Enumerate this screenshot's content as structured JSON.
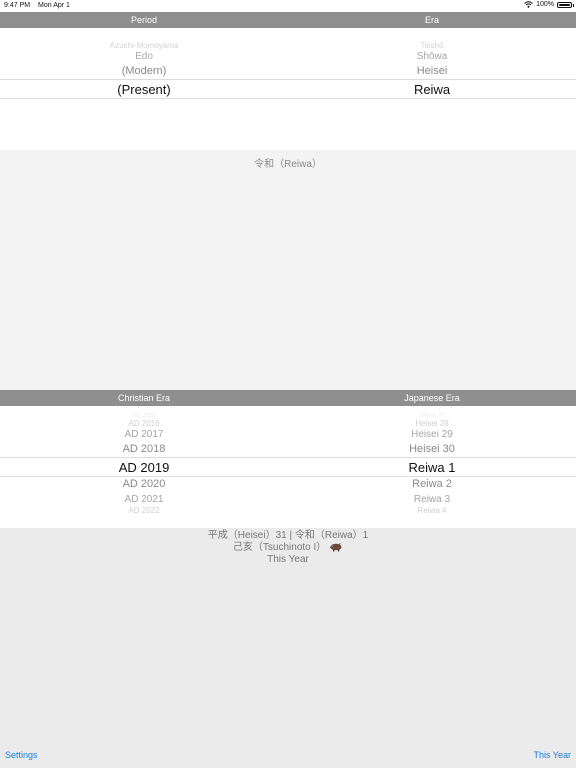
{
  "status_bar": {
    "time": "9:47 PM",
    "date": "Mon Apr 1",
    "battery": "100%"
  },
  "top_header": {
    "left": "Period",
    "right": "Era"
  },
  "top_picker": {
    "left": [
      "Azuchi-Momoyama",
      "Edo",
      "(Modern)",
      "(Present)"
    ],
    "right": [
      "Taishō",
      "Shōwa",
      "Heisei",
      "Reiwa"
    ]
  },
  "top_panel": {
    "text": "令和（Reiwa）"
  },
  "bottom_header": {
    "left": "Christian Era",
    "right": "Japanese Era"
  },
  "bottom_picker": {
    "left": [
      "AD 2015",
      "AD 2016",
      "AD 2017",
      "AD 2018",
      "AD 2019",
      "AD 2020",
      "AD 2021",
      "AD 2022"
    ],
    "right": [
      "Heisei 27",
      "Heisei 28",
      "Heisei 29",
      "Heisei 30",
      "Reiwa 1",
      "Reiwa 2",
      "Reiwa 3",
      "Reiwa 4"
    ]
  },
  "info": {
    "line1": "平成（Heisei）31 | 令和（Reiwa）1",
    "line2": "己亥（Tsuchinoto I）",
    "zodiac_icon": "boar-icon",
    "line3": "This Year"
  },
  "footer": {
    "settings": "Settings",
    "this_year": "This Year"
  },
  "colors": {
    "link": "#1a7fe0",
    "header": "#8f8f8f"
  }
}
